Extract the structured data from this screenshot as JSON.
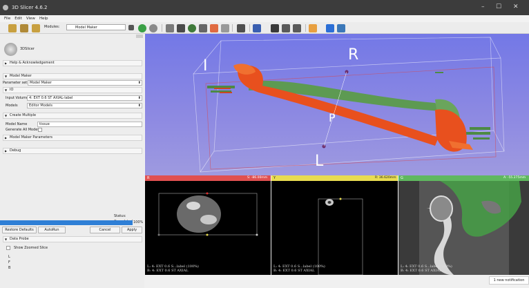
{
  "window": {
    "title": "3D Slicer 4.6.2",
    "minimize": "–",
    "maximize": "☐",
    "close": "✕"
  },
  "menu": [
    "File",
    "Edit",
    "View",
    "Help"
  ],
  "toolbar": {
    "modules_label": "Modules:",
    "module_selected": "Model Maker"
  },
  "module_panel": {
    "logo_text": "3DSlicer",
    "help_section": "Help & Acknowledgement",
    "model_maker_section": "Model Maker",
    "parameter_set_label": "Parameter set:",
    "parameter_set_value": "Model Maker",
    "io_section": "IO",
    "input_volume_label": "Input Volume",
    "input_volume_value": "4: EXT 0.6 ST AXIAL-label",
    "models_label": "Models",
    "models_value": "Editor Models",
    "create_multiple_section": "Create Multiple",
    "model_name_label": "Model Name",
    "model_name_value": "tissue",
    "generate_all_label": "Generate All Models",
    "parameters_section": "Model Maker Parameters",
    "debug_section": "Debug",
    "status": "Status: Completed",
    "progress_text": "100%",
    "progress_fraction": 1.0,
    "restore_defaults": "Restore Defaults",
    "autorun": "AutoRun",
    "cancel": "Cancel",
    "apply": "Apply",
    "data_probe_section": "Data Probe",
    "show_zoomed_label": "Show Zoomed Slice",
    "probe_L": "L",
    "probe_F": "F",
    "probe_B": "B"
  },
  "view3d": {
    "label_R": "R",
    "label_I": "I",
    "label_P": "P",
    "label_L": "L"
  },
  "slices": [
    {
      "name": "red",
      "letter": "R",
      "bar_color": "#e05050",
      "offset": "S: -86.00mm",
      "line1": "L: 4: EXT 0.6 S...label (100%)",
      "line2": "B: 4: EXT 0.6 ST AXIAL"
    },
    {
      "name": "yellow",
      "letter": "Y",
      "bar_color": "#e8dc50",
      "offset": "R: 36.620mm",
      "line1": "L: 4: EXT 0.6 S...label (100%)",
      "line2": "B: 4: EXT 0.6 ST AXIAL"
    },
    {
      "name": "green",
      "letter": "G",
      "bar_color": "#5fb85f",
      "offset": "A: -55.275mm",
      "line1": "L: 4: EXT 0.6 S...label (100%)",
      "line2": "B: 4: EXT 0.6 ST AXIAL"
    }
  ],
  "notification": "1 new notification",
  "colors": {
    "accent": "#2f7fd6",
    "bone_orange": "#e8501e",
    "bone_green": "#5d9a52",
    "view_bg": "#7c7ee4"
  }
}
